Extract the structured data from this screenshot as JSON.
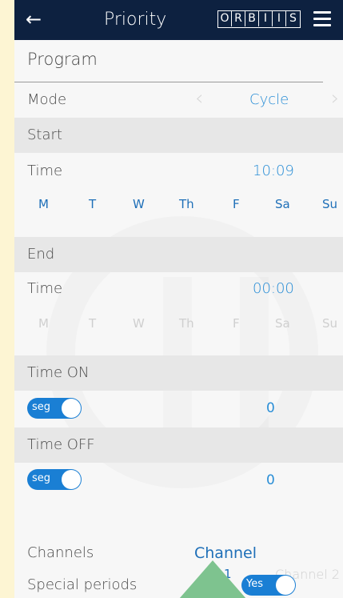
{
  "header": {
    "title": "Priority",
    "logo_letters": [
      "O",
      "R",
      "B",
      "I",
      "I",
      "S"
    ],
    "back_icon": "arrow-left-icon",
    "menu_icon": "hamburger-icon"
  },
  "program": {
    "heading": "Program",
    "mode_label": "Mode",
    "mode_value": "Cycle"
  },
  "start": {
    "heading": "Start",
    "time_label": "Time",
    "time_value": "10:09",
    "days": [
      "M",
      "T",
      "W",
      "Th",
      "F",
      "Sa",
      "Su"
    ]
  },
  "end": {
    "heading": "End",
    "time_label": "Time",
    "time_value": "00:00",
    "days": [
      "M",
      "T",
      "W",
      "Th",
      "F",
      "Sa",
      "Su"
    ]
  },
  "time_on": {
    "heading": "Time ON",
    "toggle_label": "seg",
    "value": "0"
  },
  "time_off": {
    "heading": "Time OFF",
    "toggle_label": "seg",
    "value": "0"
  },
  "channels": {
    "label": "Channels",
    "value": "Channel",
    "channel_number": "1",
    "channel2": "Channel 2"
  },
  "special": {
    "label": "Special periods",
    "toggle_label": "Yes"
  },
  "colors": {
    "header_bg": "#0d2140",
    "accent": "#2a8ed6",
    "toggle": "#1a7fd4",
    "annotation_arrow": "#7ec38f"
  }
}
